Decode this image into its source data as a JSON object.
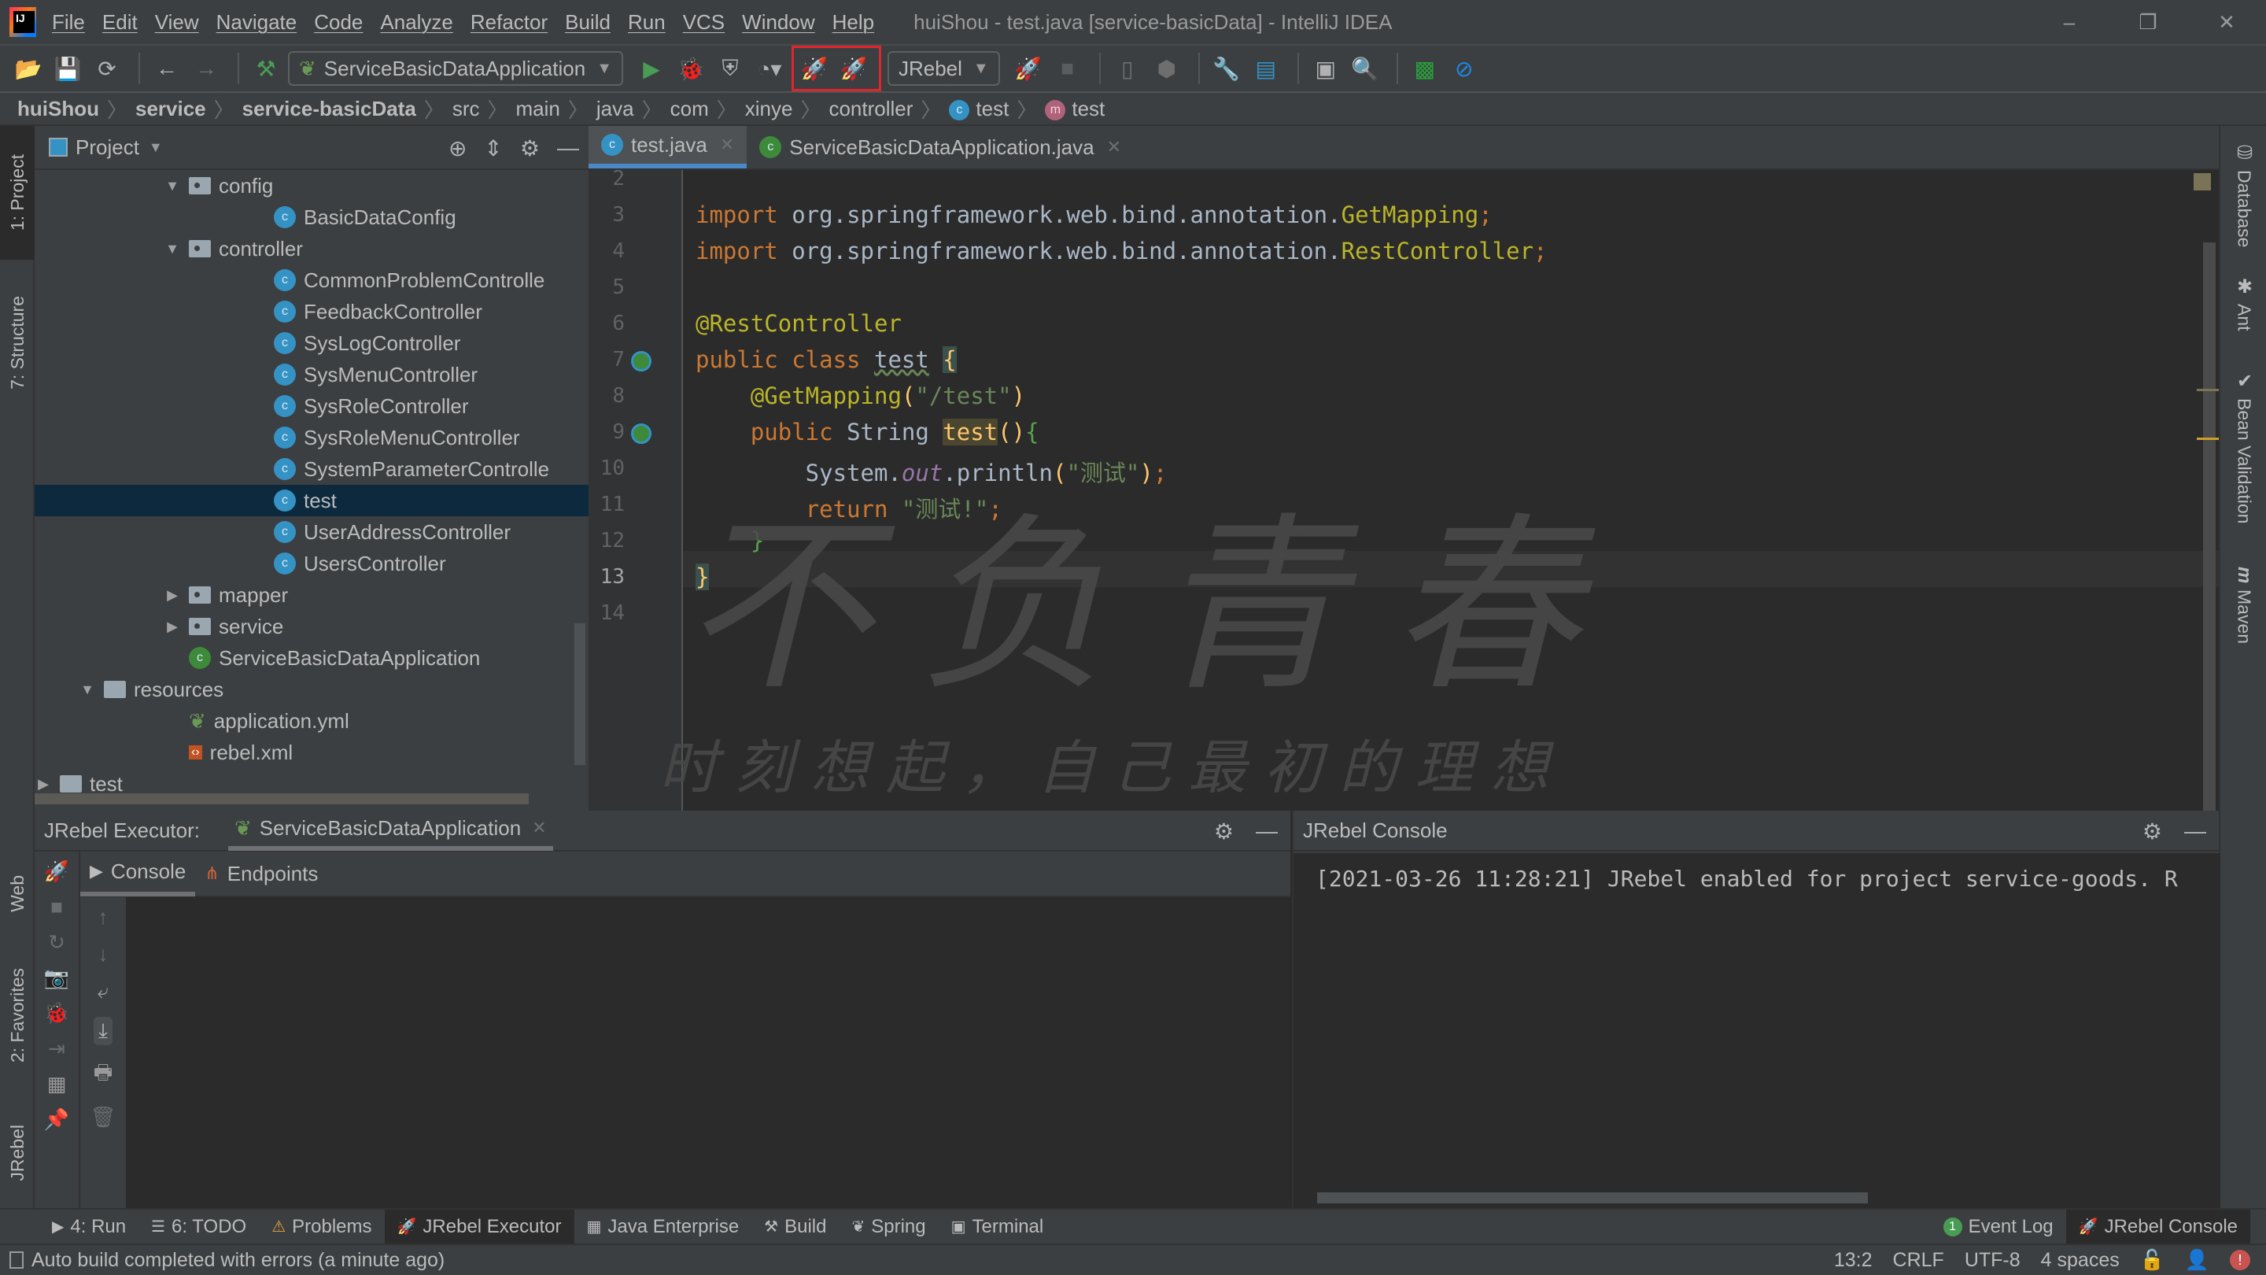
{
  "app": {
    "window_title": "huiShou - test.java [service-basicData] - IntelliJ IDEA",
    "menu": [
      "File",
      "Edit",
      "View",
      "Navigate",
      "Code",
      "Analyze",
      "Refactor",
      "Build",
      "Run",
      "VCS",
      "Window",
      "Help"
    ],
    "window_controls": {
      "minimize": "–",
      "restore": "❐",
      "close": "✕"
    }
  },
  "toolbar": {
    "run_config": "ServiceBasicDataApplication",
    "jrebel_combo": "JRebel",
    "icons": [
      "open-folder-icon",
      "save-icon",
      "sync-icon",
      "back-icon",
      "forward-icon",
      "build-hammer-icon",
      "run-icon",
      "debug-icon",
      "coverage-icon",
      "profile-icon",
      "jrebel-run-icon",
      "jrebel-debug-icon",
      "jrebel-stop-icon",
      "stop-icon",
      "device-icon",
      "package-icon",
      "wrench-icon",
      "project-structure-icon",
      "terminal-icon",
      "search-icon",
      "monitor-icon",
      "no-entry-icon"
    ]
  },
  "breadcrumb": {
    "items": [
      "huiShou",
      "service",
      "service-basicData",
      "src",
      "main",
      "java",
      "com",
      "xinye",
      "controller"
    ],
    "class_item": "test",
    "method_item": "test",
    "class_badge": "c",
    "method_badge": "m"
  },
  "left_stripe": {
    "project": "1: Project",
    "structure": "7: Structure",
    "web": "Web",
    "favorites": "2: Favorites",
    "jrebel": "JRebel"
  },
  "project_panel": {
    "title": "Project",
    "tree": [
      {
        "label": "config",
        "type": "package",
        "expanded": true,
        "depth": 3
      },
      {
        "label": "BasicDataConfig",
        "type": "class",
        "depth": 4
      },
      {
        "label": "controller",
        "type": "package",
        "expanded": true,
        "depth": 3
      },
      {
        "label": "CommonProblemControlle",
        "type": "class",
        "depth": 4
      },
      {
        "label": "FeedbackController",
        "type": "class",
        "depth": 4
      },
      {
        "label": "SysLogController",
        "type": "class",
        "depth": 4
      },
      {
        "label": "SysMenuController",
        "type": "class",
        "depth": 4
      },
      {
        "label": "SysRoleController",
        "type": "class",
        "depth": 4
      },
      {
        "label": "SysRoleMenuController",
        "type": "class",
        "depth": 4
      },
      {
        "label": "SystemParameterControlle",
        "type": "class",
        "depth": 4
      },
      {
        "label": "test",
        "type": "class",
        "depth": 4,
        "selected": true
      },
      {
        "label": "UserAddressController",
        "type": "class",
        "depth": 4
      },
      {
        "label": "UsersController",
        "type": "class",
        "depth": 4
      },
      {
        "label": "mapper",
        "type": "package",
        "expanded": false,
        "depth": 3
      },
      {
        "label": "service",
        "type": "package",
        "expanded": false,
        "depth": 3
      },
      {
        "label": "ServiceBasicDataApplication",
        "type": "spring-class",
        "depth": 3
      },
      {
        "label": "resources",
        "type": "resources",
        "expanded": true,
        "depth": 2
      },
      {
        "label": "application.yml",
        "type": "yml",
        "depth": 3
      },
      {
        "label": "rebel.xml",
        "type": "xml",
        "depth": 3
      },
      {
        "label": "test",
        "type": "folder",
        "expanded": false,
        "depth": 1
      }
    ]
  },
  "editor": {
    "tabs": [
      {
        "label": "test.java",
        "active": true
      },
      {
        "label": "ServiceBasicDataApplication.java",
        "active": false
      }
    ],
    "lines": [
      {
        "n": "2",
        "html": ""
      },
      {
        "n": "3",
        "html": "<span class='kw'>import</span> org.springframework.web.bind.annotation.<span class='ann'>GetMapping</span><span class='semi'>;</span>"
      },
      {
        "n": "4",
        "html": "<span class='kw'>import</span> org.springframework.web.bind.annotation.<span class='ann'>RestController</span><span class='semi'>;</span>"
      },
      {
        "n": "5",
        "html": ""
      },
      {
        "n": "6",
        "html": "<span class='ann'>@RestController</span>"
      },
      {
        "n": "7",
        "html": "<span class='kw'>public class</span> <span style='text-decoration:underline wavy #6a8759'>test</span> <span class='brace-y hl-box'>{</span>"
      },
      {
        "n": "8",
        "html": "    <span class='ann'>@GetMapping</span><span class='brace-y'>(</span><span class='str'>\"/test\"</span><span class='brace-y'>)</span>"
      },
      {
        "n": "9",
        "html": "    <span class='kw'>public</span> String <span class='hl-test'>test</span><span class='brace-y'>()</span><span class='brace-g'>{</span>"
      },
      {
        "n": "10",
        "html": "        System.<span class='field'>out</span>.println<span class='brace-y'>(</span><span class='str'>\"测试\"</span><span class='brace-y'>)</span><span class='semi'>;</span>"
      },
      {
        "n": "11",
        "html": "        <span class='kw'>return</span> <span class='str'>\"测试!\"</span><span class='semi'>;</span>"
      },
      {
        "n": "12",
        "html": "    <span class='brace-g'>}</span>"
      },
      {
        "n": "13",
        "html": "<span class='brace-y hl-box'>}</span>"
      },
      {
        "n": "14",
        "html": ""
      }
    ],
    "caret": "13:2",
    "watermark_big": "不负青春",
    "watermark_small": "时刻想起，自己最初的理想"
  },
  "right_stripe": [
    "Database",
    "Ant",
    "Bean Validation",
    "Maven"
  ],
  "executor_panel": {
    "label": "JRebel Executor:",
    "tab": "ServiceBasicDataApplication",
    "subtabs": [
      "Console",
      "Endpoints"
    ]
  },
  "jrebel_console": {
    "title": "JRebel Console",
    "log_line": "[2021-03-26 11:28:21] JRebel enabled for project service-goods. R"
  },
  "tool_tabs": {
    "left": [
      {
        "label": "4: Run",
        "icon": "▶"
      },
      {
        "label": "6: TODO",
        "icon": "☰"
      },
      {
        "label": "Problems",
        "icon": "⚠"
      },
      {
        "label": "JRebel Executor",
        "icon": "🚀",
        "active": true
      },
      {
        "label": "Java Enterprise",
        "icon": "▦"
      },
      {
        "label": "Build",
        "icon": "⚒"
      },
      {
        "label": "Spring",
        "icon": "❦"
      },
      {
        "label": "Terminal",
        "icon": "▣"
      }
    ],
    "event_log": "Event Log",
    "event_count": "1",
    "jrebel_console": "JRebel Console"
  },
  "status_bar": {
    "message": "Auto build completed with errors (a minute ago)",
    "position": "13:2",
    "line_sep": "CRLF",
    "encoding": "UTF-8",
    "indent": "4 spaces"
  }
}
